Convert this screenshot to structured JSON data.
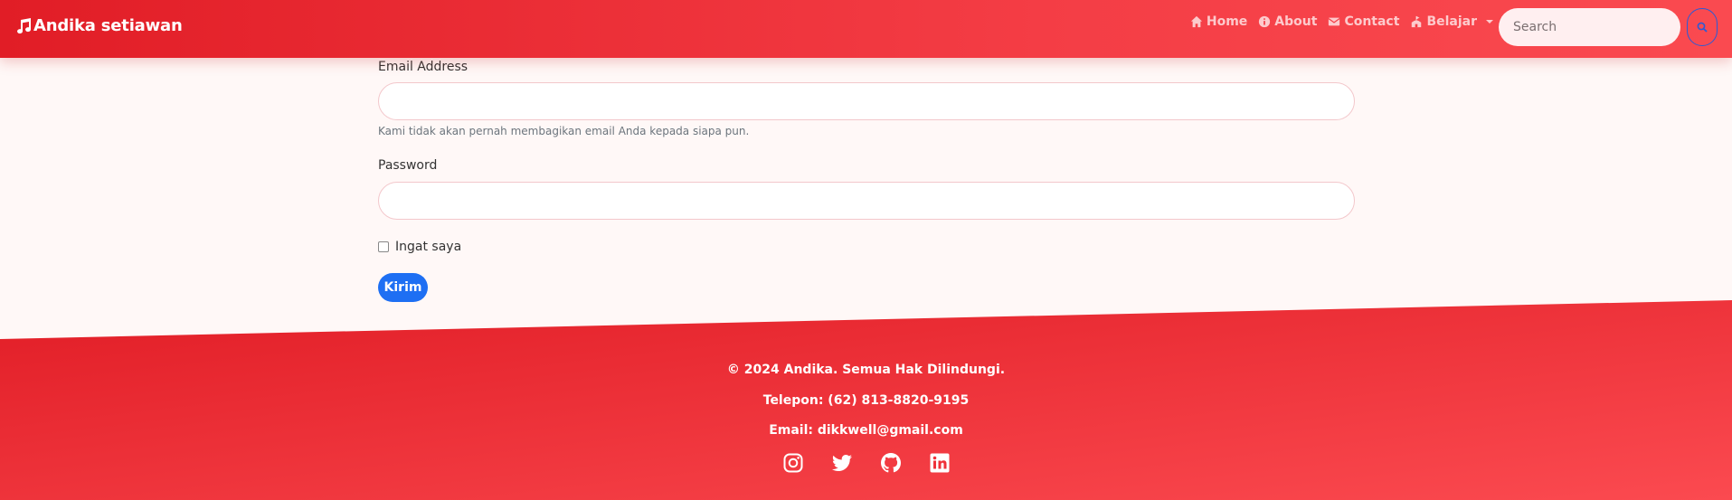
{
  "nav": {
    "brand": "Andika setiawan",
    "links": [
      {
        "label": "Home",
        "icon": "home-icon"
      },
      {
        "label": "About",
        "icon": "info-icon"
      },
      {
        "label": "Contact",
        "icon": "envelope-icon"
      },
      {
        "label": "Belajar",
        "icon": "school-icon"
      }
    ],
    "search_placeholder": "Search"
  },
  "form": {
    "email_label": "Email Address",
    "email_value": "",
    "email_help": "Kami tidak akan pernah membagikan email Anda kepada siapa pun.",
    "password_label": "Password",
    "password_value": "",
    "remember_label": "Ingat saya",
    "submit_label": "Kirim"
  },
  "footer": {
    "copyright": "© 2024 Andika. Semua Hak Dilindungi.",
    "phone": "Telepon: (62) 813-8820-9195",
    "email": "Email: dikkwell@gmail.com",
    "socials": [
      "instagram-icon",
      "twitter-icon",
      "github-icon",
      "linkedin-icon"
    ]
  },
  "colors": {
    "primary_red": "#e11d26",
    "accent_red": "#fa4a50",
    "button_blue": "#1e6ff3",
    "page_bg": "#fff8f7"
  }
}
